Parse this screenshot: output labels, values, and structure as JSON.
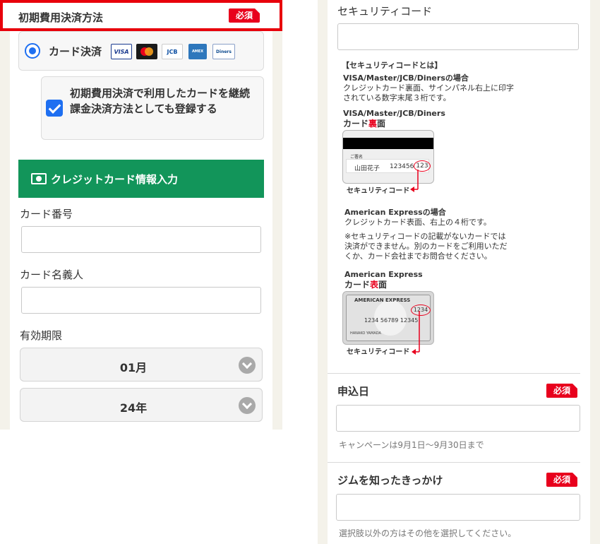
{
  "left": {
    "section_title": "初期費用決済方法",
    "required_badge": "必須",
    "payment_option": {
      "label": "カード決済",
      "selected": true,
      "card_brands": [
        "VISA",
        "MasterCard",
        "JCB",
        "AMERICAN EXPRESS",
        "Diners Club"
      ]
    },
    "register_checkbox": {
      "label": "初期費用決済で利用したカードを継続課金決済方法としても登録する",
      "checked": true
    },
    "card_section_title": "クレジットカード情報入力",
    "card_number_label": "カード番号",
    "card_name_label": "カード名義人",
    "expiry_label": "有効期限",
    "expiry_month": "01月",
    "expiry_year": "24年"
  },
  "right": {
    "security_code_label": "セキュリティコード",
    "about_heading": "【セキュリティコードとは】",
    "visa_group_heading": "VISA/Master/JCB/Dinersの場合",
    "visa_group_text_1": "クレジットカード裏面、サインパネル右上に印字",
    "visa_group_text_2": "されている数字末尾３桁です。",
    "visa_card_brands": "VISA/Master/JCB/Diners",
    "card_back_prefix": "カード",
    "card_back_emph": "裏",
    "card_back_suffix": "面",
    "sig_label": "ご署名",
    "sig_name": "山田花子",
    "sig_digits": "123456",
    "sig_code": "123",
    "security_code_caption": "セキュリティコード",
    "amex_heading": "American Expressの場合",
    "amex_text": "クレジットカード表面、右上の４桁です。",
    "notice_1": "※セキュリティコードの記載がないカードでは",
    "notice_2": "決済ができません。別のカードをご利用いただ",
    "notice_3": "くか、カード会社までお問合せください。",
    "amex_brand": "American Express",
    "card_front_prefix": "カード",
    "card_front_emph": "表",
    "card_front_suffix": "面",
    "amex_card_title": "AMERICAN EXPRESS",
    "amex_code": "1234",
    "amex_number": "1234 56789 12345",
    "amex_holder": "HANAKO YAMADA",
    "application_date_label": "申込日",
    "required_badge": "必須",
    "campaign_hint": "キャンペーンは9月1日〜9月30日まで",
    "gym_reason_label": "ジムを知ったきっかけ",
    "gym_reason_hint": "選択肢以外の方はその他を選択してください。"
  },
  "colors": {
    "accent_red": "#e8001d",
    "accent_green": "#12955a",
    "accent_blue": "#1e6ff1"
  }
}
